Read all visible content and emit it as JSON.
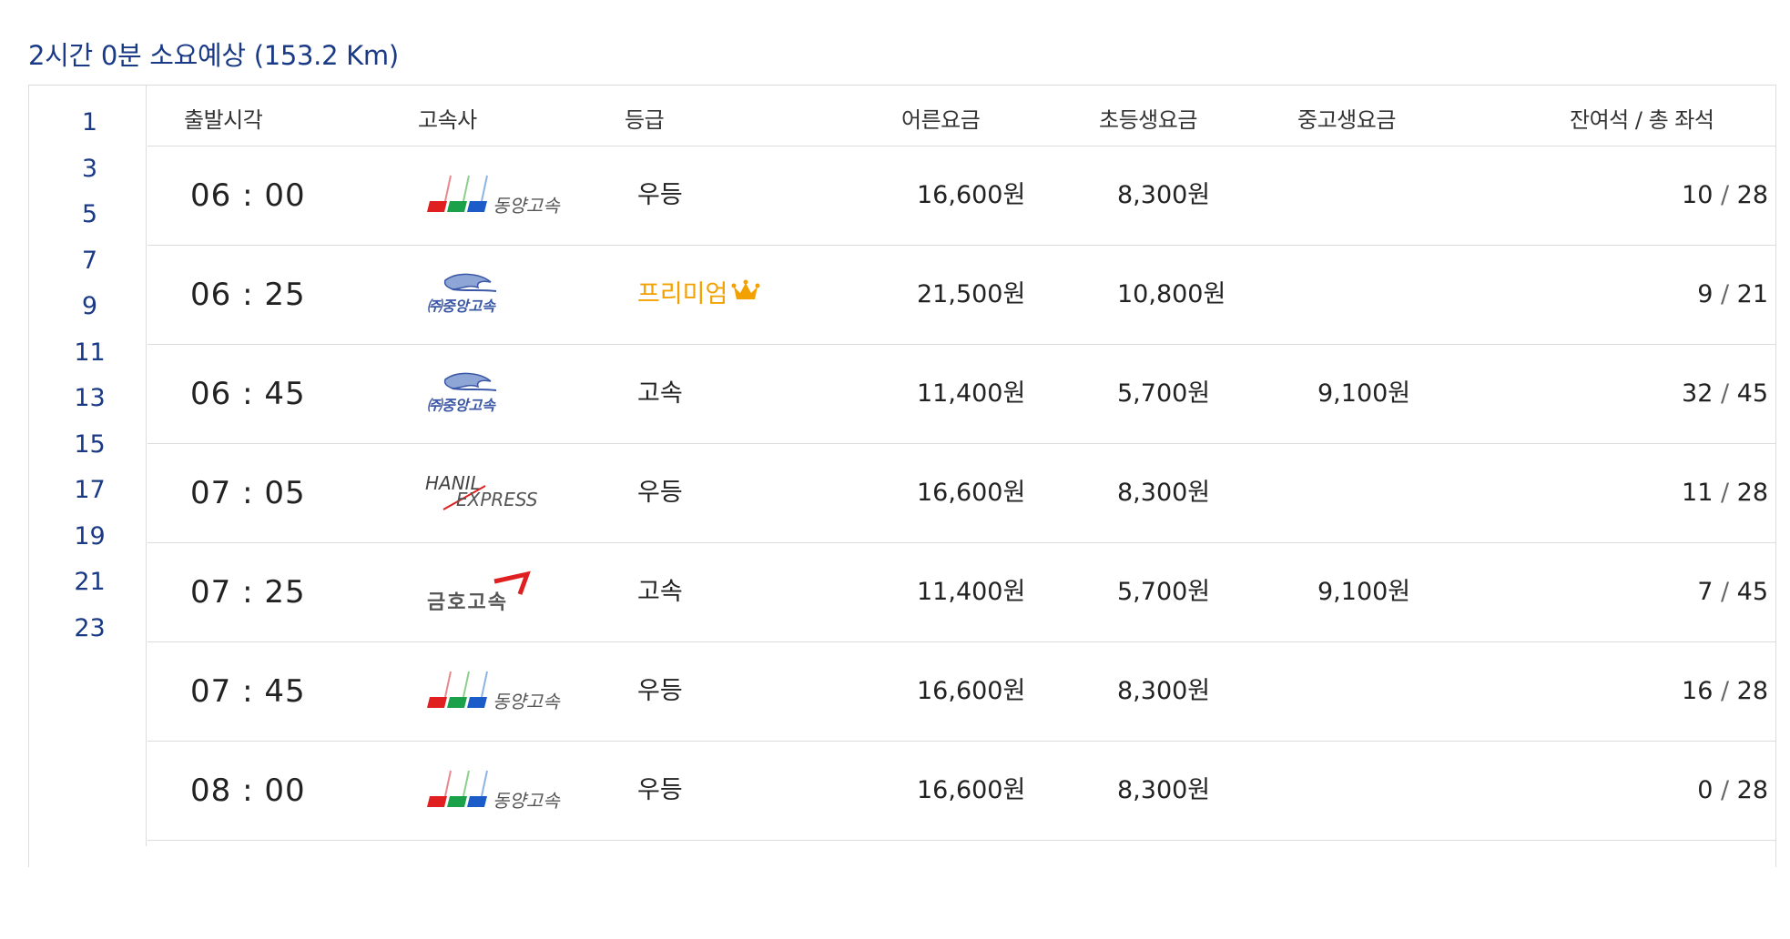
{
  "summary": "2시간 0분 소요예상 (153.2 Km)",
  "hours": [
    "1",
    "3",
    "5",
    "7",
    "9",
    "11",
    "13",
    "15",
    "17",
    "19",
    "21",
    "23"
  ],
  "headers": {
    "time": "출발시각",
    "company": "고속사",
    "grade": "등급",
    "adult": "어른요금",
    "child": "초등생요금",
    "teen": "중고생요금",
    "seats": "잔여석 / 총 좌석"
  },
  "rows": [
    {
      "time": "06 : 00",
      "company": "dongyang-logo",
      "grade": "우등",
      "adult": "16,600원",
      "child": "8,300원",
      "teen": "",
      "remain": "10",
      "total": "28"
    },
    {
      "time": "06 : 25",
      "company": "jungang-logo",
      "grade": "프리미엄",
      "adult": "21,500원",
      "child": "10,800원",
      "teen": "",
      "remain": "9",
      "total": "21"
    },
    {
      "time": "06 : 45",
      "company": "jungang-logo",
      "grade": "고속",
      "adult": "11,400원",
      "child": "5,700원",
      "teen": "9,100원",
      "remain": "32",
      "total": "45"
    },
    {
      "time": "07 : 05",
      "company": "hanil-logo",
      "grade": "우등",
      "adult": "16,600원",
      "child": "8,300원",
      "teen": "",
      "remain": "11",
      "total": "28"
    },
    {
      "time": "07 : 25",
      "company": "kumho-logo",
      "grade": "고속",
      "adult": "11,400원",
      "child": "5,700원",
      "teen": "9,100원",
      "remain": "7",
      "total": "45"
    },
    {
      "time": "07 : 45",
      "company": "dongyang-logo",
      "grade": "우등",
      "adult": "16,600원",
      "child": "8,300원",
      "teen": "",
      "remain": "16",
      "total": "28"
    },
    {
      "time": "08 : 00",
      "company": "dongyang-logo",
      "grade": "우등",
      "adult": "16,600원",
      "child": "8,300원",
      "teen": "",
      "remain": "0",
      "total": "28"
    }
  ],
  "colors": {
    "accent": "#1a3a86",
    "premium": "#f2a100",
    "border": "#dcdcdc"
  }
}
